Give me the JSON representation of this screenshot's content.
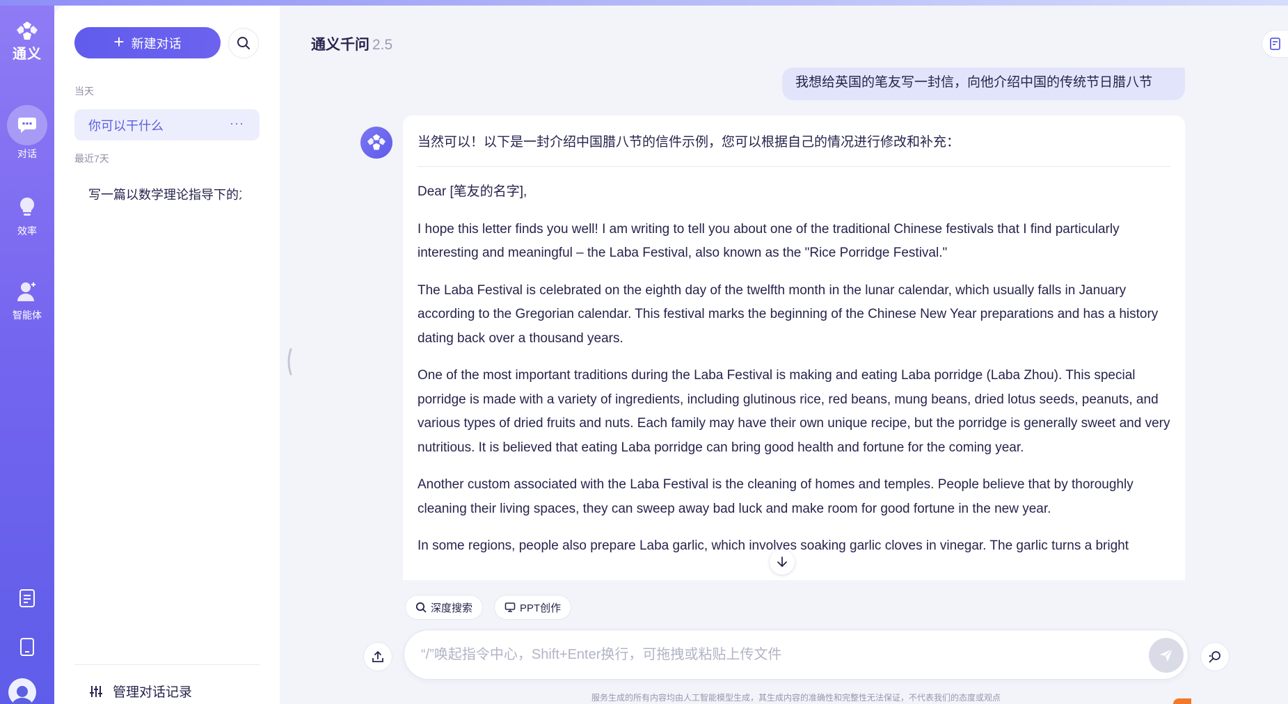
{
  "colors": {
    "accent": "#615ced",
    "rail_gradient_top": "#8f7bf4",
    "rail_gradient_bottom": "#5e5de9",
    "user_bubble": "#e2e4fb",
    "active_item_text": "#5b5fe0"
  },
  "rail": {
    "brand": "通义",
    "items": [
      {
        "label": "对话",
        "icon": "chat-icon",
        "active": true
      },
      {
        "label": "效率",
        "icon": "lightbulb-icon",
        "active": false
      },
      {
        "label": "智能体",
        "icon": "agent-icon",
        "active": false
      }
    ],
    "bottom_icons": [
      "document-icon",
      "phone-icon",
      "avatar"
    ]
  },
  "sidebar": {
    "new_chat_label": "新建对话",
    "groups": [
      {
        "label": "当天",
        "items": [
          {
            "title": "你可以干什么",
            "active": true,
            "more": "···"
          }
        ]
      },
      {
        "label": "最近7天",
        "items": [
          {
            "title": "写一篇以数学理论指导下的之",
            "active": false
          }
        ]
      }
    ],
    "manage_label": "管理对话记录"
  },
  "header": {
    "title": "通义千问",
    "version": "2.5"
  },
  "conversation": {
    "user_message": "我想给英国的笔友写一封信，向他介绍中国的传统节日腊八节",
    "answer_intro": "当然可以！以下是一封介绍中国腊八节的信件示例，您可以根据自己的情况进行修改和补充：",
    "answer_paragraphs": [
      "Dear [笔友的名字],",
      "I hope this letter finds you well! I am writing to tell you about one of the traditional Chinese festivals that I find particularly interesting and meaningful – the Laba Festival, also known as the \"Rice Porridge Festival.\"",
      "The Laba Festival is celebrated on the eighth day of the twelfth month in the lunar calendar, which usually falls in January according to the Gregorian calendar. This festival marks the beginning of the Chinese New Year preparations and has a history dating back over a thousand years.",
      "One of the most important traditions during the Laba Festival is making and eating Laba porridge (Laba Zhou). This special porridge is made with a variety of ingredients, including glutinous rice, red beans, mung beans, dried lotus seeds, peanuts, and various types of dried fruits and nuts. Each family may have their own unique recipe, but the porridge is generally sweet and very nutritious. It is believed that eating Laba porridge can bring good health and fortune for the coming year.",
      "Another custom associated with the Laba Festival is the cleaning of homes and temples. People believe that by thoroughly cleaning their living spaces, they can sweep away bad luck and make room for good fortune in the new year.",
      "In some regions, people also prepare Laba garlic, which involves soaking garlic cloves in vinegar. The garlic turns a bright"
    ]
  },
  "tools": {
    "deep_search": "深度搜索",
    "ppt_create": "PPT创作"
  },
  "composer": {
    "placeholder": "“/”唤起指令中心，Shift+Enter换行，可拖拽或粘贴上传文件",
    "value": ""
  },
  "disclaimer": "服务生成的所有内容均由人工智能模型生成，其生成内容的准确性和完整性无法保证，不代表我们的态度或观点"
}
